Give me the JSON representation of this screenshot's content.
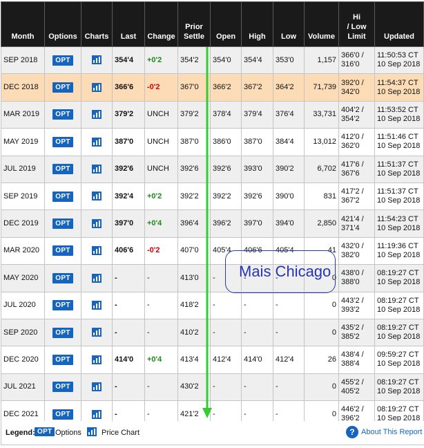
{
  "columns": [
    "Month",
    "Options",
    "Charts",
    "Last",
    "Change",
    "Prior\nSettle",
    "Open",
    "High",
    "Low",
    "Volume",
    "Hi\n/ Low\nLimit",
    "Updated"
  ],
  "option_label": "OPT",
  "rows": [
    {
      "month": "SEP 2018",
      "last": "354'4",
      "change": "+0'2",
      "dir": "up",
      "prior": "354'2",
      "open": "354'0",
      "high": "354'4",
      "low": "353'0",
      "volume": "1,157",
      "hi": "366'0 /",
      "lo": "316'0",
      "time": "11:50:53 CT",
      "date": "10 Sep 2018"
    },
    {
      "month": "DEC 2018",
      "last": "366'6",
      "change": "-0'2",
      "dir": "down",
      "prior": "367'0",
      "open": "366'2",
      "high": "367'2",
      "low": "364'2",
      "volume": "71,739",
      "hi": "392'0 /",
      "lo": "342'0",
      "time": "11:54:37 CT",
      "date": "10 Sep 2018"
    },
    {
      "month": "MAR 2019",
      "last": "379'2",
      "change": "UNCH",
      "dir": "unch",
      "prior": "379'2",
      "open": "378'4",
      "high": "379'4",
      "low": "376'4",
      "volume": "33,731",
      "hi": "404'2 /",
      "lo": "354'2",
      "time": "11:53:52 CT",
      "date": "10 Sep 2018"
    },
    {
      "month": "MAY 2019",
      "last": "387'0",
      "change": "UNCH",
      "dir": "unch",
      "prior": "387'0",
      "open": "386'0",
      "high": "387'0",
      "low": "384'4",
      "volume": "13,012",
      "hi": "412'0 /",
      "lo": "362'0",
      "time": "11:51:46 CT",
      "date": "10 Sep 2018"
    },
    {
      "month": "JUL 2019",
      "last": "392'6",
      "change": "UNCH",
      "dir": "unch",
      "prior": "392'6",
      "open": "392'6",
      "high": "393'0",
      "low": "390'2",
      "volume": "6,702",
      "hi": "417'6 /",
      "lo": "367'6",
      "time": "11:51:37 CT",
      "date": "10 Sep 2018"
    },
    {
      "month": "SEP 2019",
      "last": "392'4",
      "change": "+0'2",
      "dir": "up",
      "prior": "392'2",
      "open": "392'2",
      "high": "392'6",
      "low": "390'0",
      "volume": "831",
      "hi": "417'2 /",
      "lo": "367'2",
      "time": "11:51:37 CT",
      "date": "10 Sep 2018"
    },
    {
      "month": "DEC 2019",
      "last": "397'0",
      "change": "+0'4",
      "dir": "up",
      "prior": "396'4",
      "open": "396'2",
      "high": "397'0",
      "low": "394'0",
      "volume": "2,850",
      "hi": "421'4 /",
      "lo": "371'4",
      "time": "11:54:23 CT",
      "date": "10 Sep 2018"
    },
    {
      "month": "MAR 2020",
      "last": "406'6",
      "change": "-0'2",
      "dir": "down",
      "prior": "407'0",
      "open": "405'4",
      "high": "406'6",
      "low": "405'4",
      "volume": "41",
      "hi": "432'0 /",
      "lo": "382'0",
      "time": "11:19:36 CT",
      "date": "10 Sep 2018"
    },
    {
      "month": "MAY 2020",
      "last": "-",
      "change": "-",
      "dir": "unch",
      "prior": "413'0",
      "open": "-",
      "high": "-",
      "low": "-",
      "volume": "0",
      "hi": "438'0 /",
      "lo": "388'0",
      "time": "08:19:27 CT",
      "date": "10 Sep 2018"
    },
    {
      "month": "JUL 2020",
      "last": "-",
      "change": "-",
      "dir": "unch",
      "prior": "418'2",
      "open": "-",
      "high": "-",
      "low": "-",
      "volume": "0",
      "hi": "443'2 /",
      "lo": "393'2",
      "time": "08:19:27 CT",
      "date": "10 Sep 2018"
    },
    {
      "month": "SEP 2020",
      "last": "-",
      "change": "-",
      "dir": "unch",
      "prior": "410'2",
      "open": "-",
      "high": "-",
      "low": "-",
      "volume": "0",
      "hi": "435'2 /",
      "lo": "385'2",
      "time": "08:19:27 CT",
      "date": "10 Sep 2018"
    },
    {
      "month": "DEC 2020",
      "last": "414'0",
      "change": "+0'4",
      "dir": "up",
      "prior": "413'4",
      "open": "412'4",
      "high": "414'0",
      "low": "412'4",
      "volume": "26",
      "hi": "438'4 /",
      "lo": "388'4",
      "time": "09:59:27 CT",
      "date": "10 Sep 2018"
    },
    {
      "month": "JUL 2021",
      "last": "-",
      "change": "-",
      "dir": "unch",
      "prior": "430'2",
      "open": "-",
      "high": "-",
      "low": "-",
      "volume": "0",
      "hi": "455'2 /",
      "lo": "405'2",
      "time": "08:19:27 CT",
      "date": "10 Sep 2018"
    },
    {
      "month": "DEC 2021",
      "last": "-",
      "change": "-",
      "dir": "unch",
      "prior": "421'2",
      "open": "-",
      "high": "-",
      "low": "-",
      "volume": "0",
      "hi": "446'2 /",
      "lo": "396'2",
      "time": "08:19:27 CT",
      "date": "10 Sep 2018"
    }
  ],
  "legend": {
    "label": "Legend:",
    "opt_badge": "OPT",
    "options_text": "Options",
    "chart_text": "Price Chart",
    "about_icon": "?",
    "about_text": "About This Report"
  },
  "overlay": {
    "text": "Mais Chicago",
    "text_color": "#2235b8",
    "arrow_color": "#33cc33"
  },
  "colors": {
    "header_bg": "#1a1a1a",
    "highlight_row": "#fbdcb7",
    "alt_row": "#efefef",
    "up": "#1c8a1c",
    "down": "#d40000",
    "badge": "#1565c0"
  }
}
